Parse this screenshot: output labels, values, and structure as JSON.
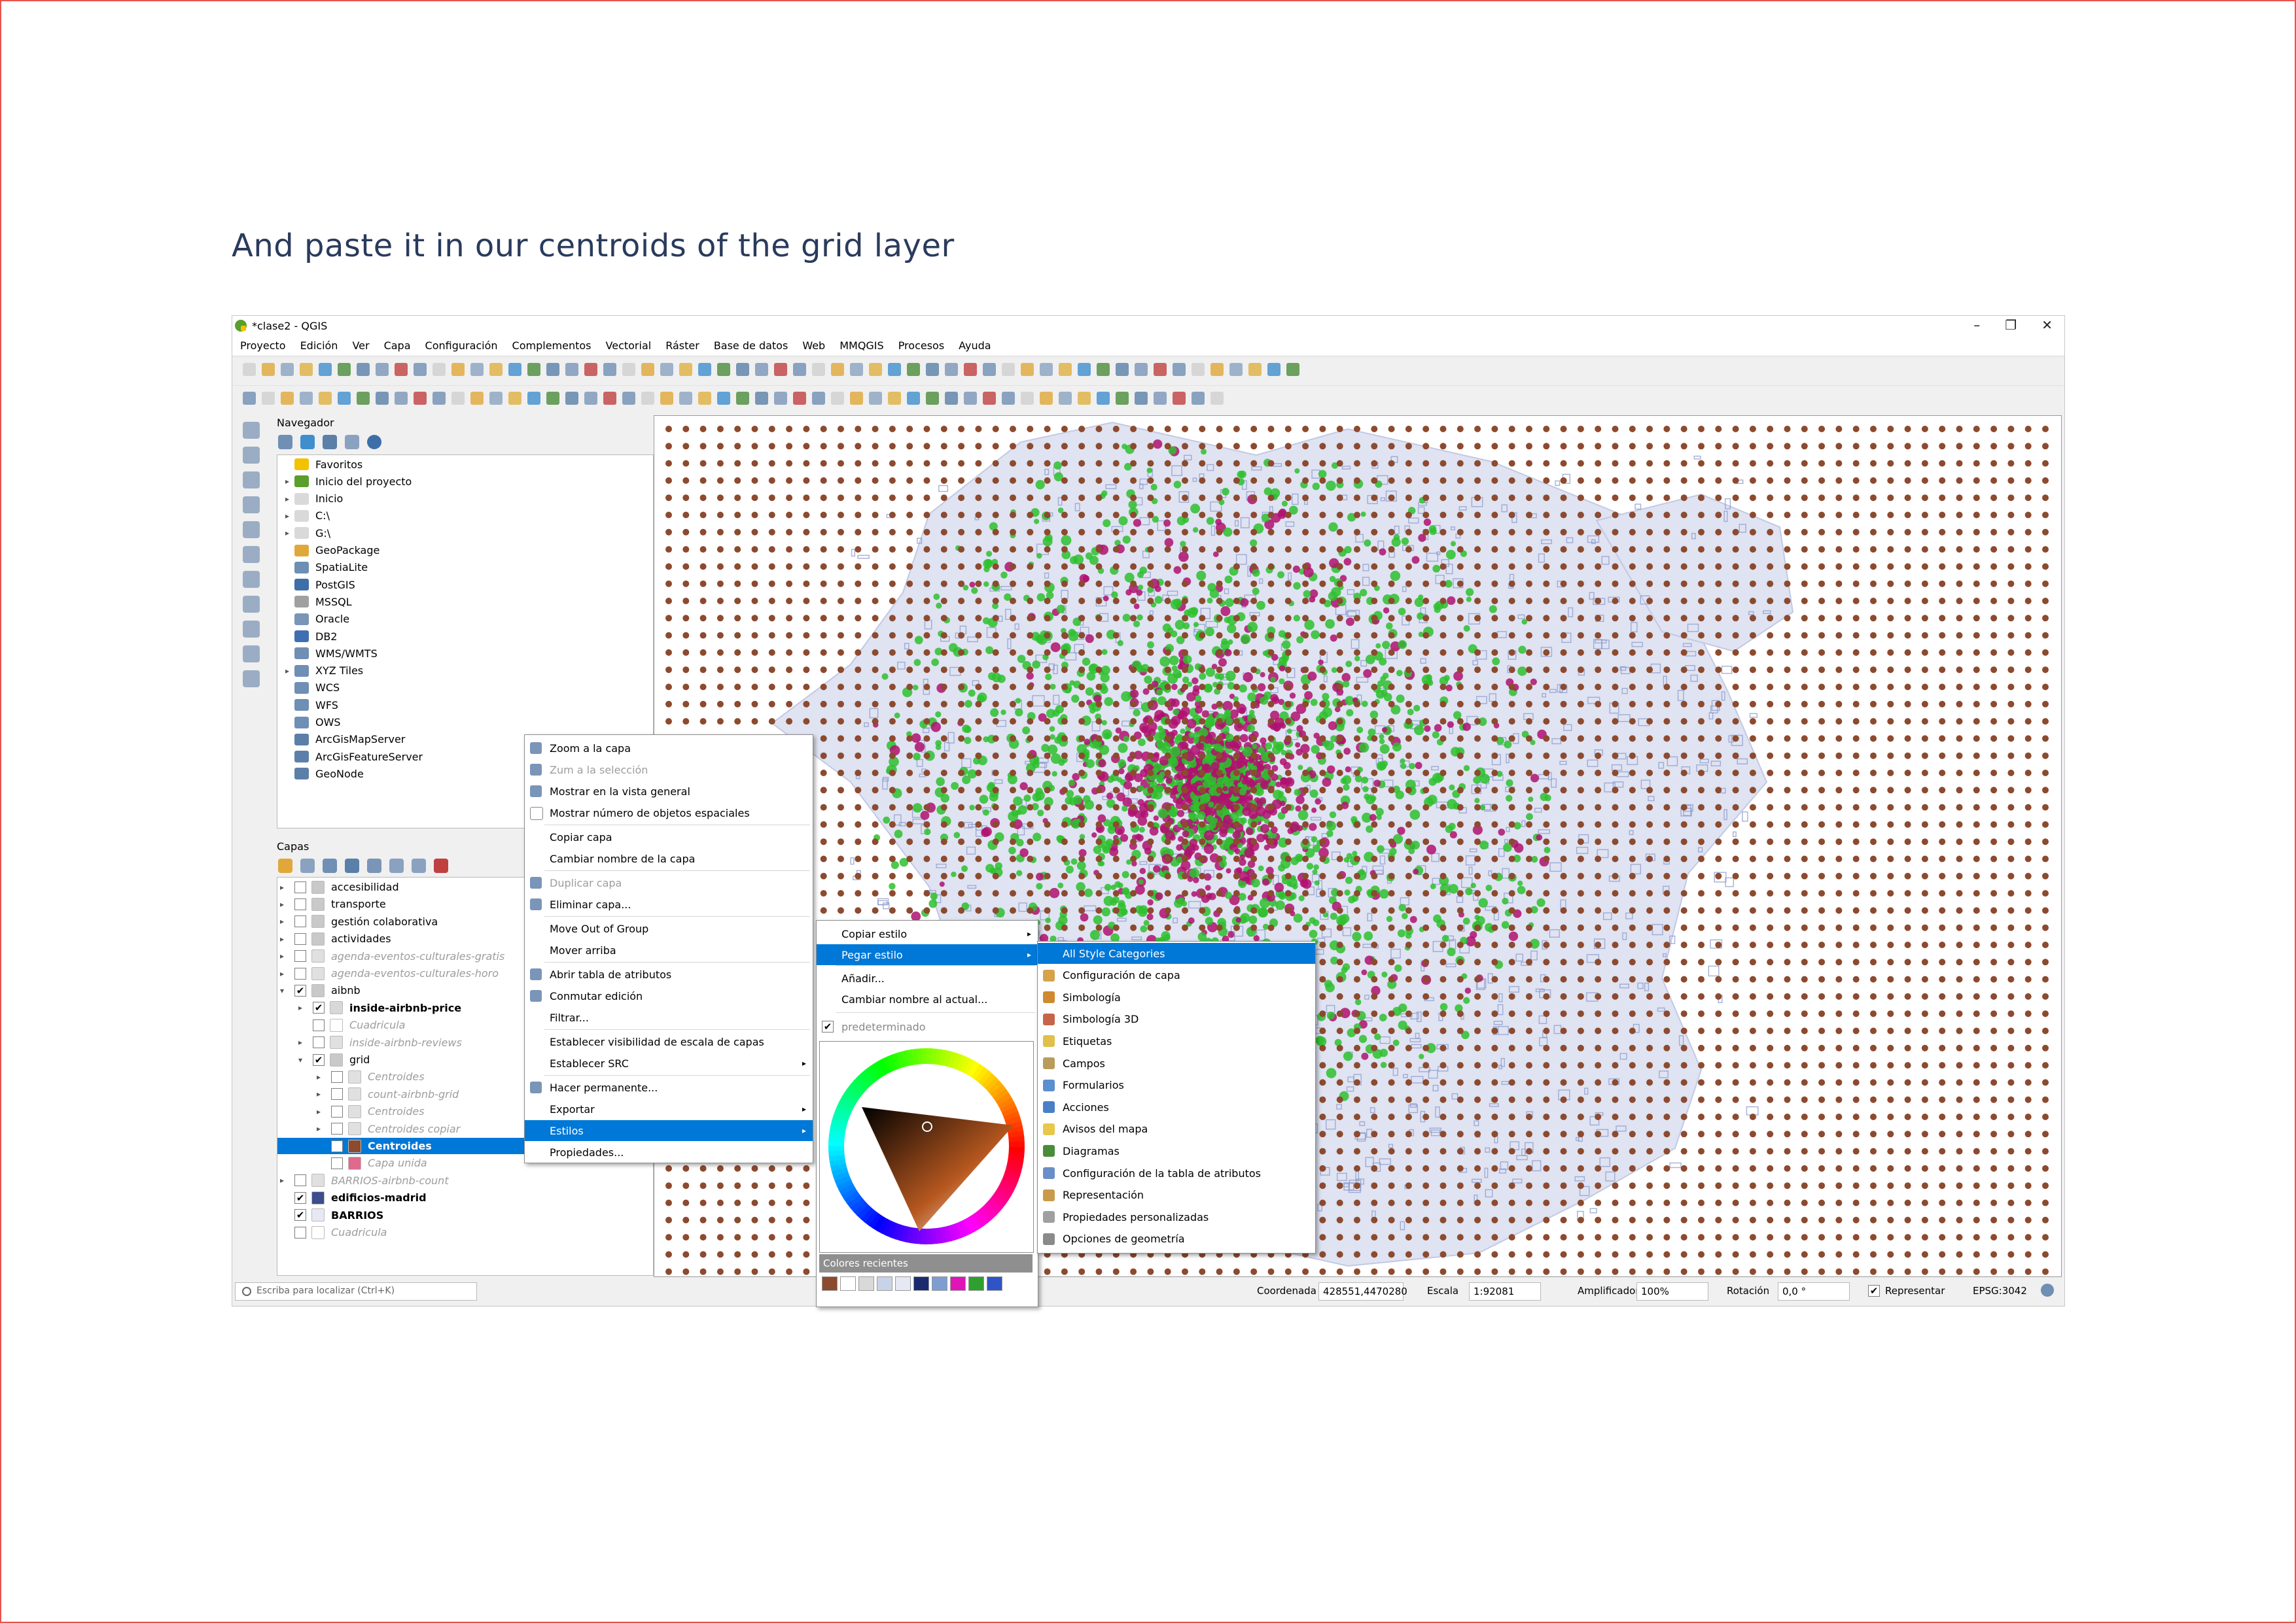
{
  "slide": {
    "title": "And paste it in our centroids of the grid layer"
  },
  "window": {
    "title": "*clase2 - QGIS",
    "minimize": "–",
    "restore": "❐",
    "close": "✕"
  },
  "menubar": [
    "Proyecto",
    "Edición",
    "Ver",
    "Capa",
    "Configuración",
    "Complementos",
    "Vectorial",
    "Ráster",
    "Base de datos",
    "Web",
    "MMQGIS",
    "Procesos",
    "Ayuda"
  ],
  "navigator": {
    "title": "Navegador",
    "items": [
      {
        "label": "Favoritos",
        "icon": "star-icon",
        "color": "#f2c200",
        "expand": ""
      },
      {
        "label": "Inicio del proyecto",
        "icon": "project-home-icon",
        "color": "#5a9e2c",
        "expand": "▸"
      },
      {
        "label": "Inicio",
        "icon": "home-folder-icon",
        "color": "#d9d9d9",
        "expand": "▸"
      },
      {
        "label": "C:\\",
        "icon": "drive-icon",
        "color": "#d9d9d9",
        "expand": "▸"
      },
      {
        "label": "G:\\",
        "icon": "drive-icon",
        "color": "#d9d9d9",
        "expand": "▸"
      },
      {
        "label": "GeoPackage",
        "icon": "geopackage-icon",
        "color": "#e0a83a",
        "expand": ""
      },
      {
        "label": "SpatiaLite",
        "icon": "spatialite-icon",
        "color": "#6d8fb3",
        "expand": ""
      },
      {
        "label": "PostGIS",
        "icon": "postgis-icon",
        "color": "#3d6ea8",
        "expand": ""
      },
      {
        "label": "MSSQL",
        "icon": "mssql-icon",
        "color": "#a0a0a0",
        "expand": ""
      },
      {
        "label": "Oracle",
        "icon": "oracle-icon",
        "color": "#7a95b8",
        "expand": ""
      },
      {
        "label": "DB2",
        "icon": "db2-icon",
        "color": "#3f6fb0",
        "expand": ""
      },
      {
        "label": "WMS/WMTS",
        "icon": "globe-icon",
        "color": "#6f8fb4",
        "expand": ""
      },
      {
        "label": "XYZ Tiles",
        "icon": "globe-icon",
        "color": "#6f8fb4",
        "expand": "▸"
      },
      {
        "label": "WCS",
        "icon": "globe-icon",
        "color": "#6f8fb4",
        "expand": ""
      },
      {
        "label": "WFS",
        "icon": "globe-icon",
        "color": "#6f8fb4",
        "expand": ""
      },
      {
        "label": "OWS",
        "icon": "globe-icon",
        "color": "#6f8fb4",
        "expand": ""
      },
      {
        "label": "ArcGisMapServer",
        "icon": "arcgis-icon",
        "color": "#5b7fa8",
        "expand": ""
      },
      {
        "label": "ArcGisFeatureServer",
        "icon": "arcgis-icon",
        "color": "#5b7fa8",
        "expand": ""
      },
      {
        "label": "GeoNode",
        "icon": "geonode-icon",
        "color": "#5b7fa8",
        "expand": ""
      }
    ]
  },
  "layers": {
    "title": "Capas",
    "rows": [
      {
        "label": "accesibilidad",
        "checked": "",
        "style": "",
        "expand": "▸",
        "level": 0,
        "icon": "group-icon",
        "color": "#c9c9c9",
        "selected": false
      },
      {
        "label": "transporte",
        "checked": "",
        "style": "",
        "expand": "▸",
        "level": 0,
        "icon": "group-icon",
        "color": "#c9c9c9",
        "selected": false
      },
      {
        "label": "gestión colaborativa",
        "checked": "",
        "style": "",
        "expand": "▸",
        "level": 0,
        "icon": "group-icon",
        "color": "#c9c9c9",
        "selected": false
      },
      {
        "label": "actividades",
        "checked": "",
        "style": "",
        "expand": "▸",
        "level": 0,
        "icon": "group-icon",
        "color": "#c9c9c9",
        "selected": false
      },
      {
        "label": "agenda-eventos-culturales-gratis",
        "checked": "",
        "style": "gray",
        "expand": "▸",
        "level": 0,
        "icon": "points-icon",
        "color": "#e0e0e0",
        "selected": false
      },
      {
        "label": "agenda-eventos-culturales-horo",
        "checked": "",
        "style": "gray",
        "expand": "▸",
        "level": 0,
        "icon": "points-icon",
        "color": "#e0e0e0",
        "selected": false
      },
      {
        "label": "aibnb",
        "checked": "✔",
        "style": "",
        "expand": "▾",
        "level": 0,
        "icon": "group-icon",
        "color": "#c9c9c9",
        "selected": false
      },
      {
        "label": "inside-airbnb-price",
        "checked": "✔",
        "style": "bold",
        "expand": "▸",
        "level": 1,
        "icon": "points-icon",
        "color": "#d8d8d8",
        "selected": false
      },
      {
        "label": "Cuadricula",
        "checked": "",
        "style": "gray",
        "expand": "",
        "level": 1,
        "icon": "blank-icon",
        "color": "#ffffff",
        "selected": false
      },
      {
        "label": "inside-airbnb-reviews",
        "checked": "",
        "style": "gray",
        "expand": "▸",
        "level": 1,
        "icon": "points-icon",
        "color": "#e0e0e0",
        "selected": false
      },
      {
        "label": "grid",
        "checked": "✔",
        "style": "",
        "expand": "▾",
        "level": 1,
        "icon": "group-icon",
        "color": "#c9c9c9",
        "selected": false
      },
      {
        "label": "Centroides",
        "checked": "",
        "style": "gray",
        "expand": "▸",
        "level": 2,
        "icon": "points-icon",
        "color": "#e0e0e0",
        "selected": false
      },
      {
        "label": "count-airbnb-grid",
        "checked": "",
        "style": "gray",
        "expand": "▸",
        "level": 2,
        "icon": "polygon-icon",
        "color": "#e0e0e0",
        "selected": false
      },
      {
        "label": "Centroides",
        "checked": "",
        "style": "gray",
        "expand": "▸",
        "level": 2,
        "icon": "points-icon",
        "color": "#e0e0e0",
        "selected": false
      },
      {
        "label": "Centroides copiar",
        "checked": "",
        "style": "gray",
        "expand": "▸",
        "level": 2,
        "icon": "points-icon",
        "color": "#e0e0e0",
        "selected": false
      },
      {
        "label": "Centroides",
        "checked": "✔",
        "style": "bold",
        "expand": "",
        "level": 2,
        "icon": "point-icon",
        "color": "#8c4a2f",
        "selected": true
      },
      {
        "label": "Capa unida",
        "checked": "",
        "style": "gray",
        "expand": "",
        "level": 2,
        "icon": "fill-icon",
        "color": "#e06a8c",
        "selected": false
      },
      {
        "label": "BARRIOS-airbnb-count",
        "checked": "",
        "style": "gray",
        "expand": "▸",
        "level": 0,
        "icon": "polygon-icon",
        "color": "#e0e0e0",
        "selected": false
      },
      {
        "label": "edificios-madrid",
        "checked": "✔",
        "style": "bold",
        "expand": "",
        "level": 0,
        "icon": "fill-icon",
        "color": "#3d4e8c",
        "selected": false
      },
      {
        "label": "BARRIOS",
        "checked": "✔",
        "style": "bold",
        "expand": "",
        "level": 0,
        "icon": "fill-icon",
        "color": "#e6e8f4",
        "selected": false
      },
      {
        "label": "Cuadricula",
        "checked": "",
        "style": "gray",
        "expand": "",
        "level": 0,
        "icon": "blank-icon",
        "color": "#ffffff",
        "selected": false
      }
    ]
  },
  "context_menu": [
    {
      "label": "Zoom a la capa",
      "icon": "zoom-layer-icon",
      "disabled": false,
      "sub": "",
      "highlight": false
    },
    {
      "label": "Zum a la selección",
      "icon": "zoom-selection-icon",
      "disabled": true,
      "sub": "",
      "highlight": false
    },
    {
      "label": "Mostrar en la vista general",
      "icon": "overview-icon",
      "disabled": false,
      "sub": "",
      "highlight": false
    },
    {
      "label": "Mostrar número de objetos espaciales",
      "icon": "checkbox-icon",
      "disabled": false,
      "sub": "",
      "highlight": false
    },
    {
      "label": "Copiar capa",
      "icon": "",
      "disabled": false,
      "sub": "",
      "highlight": false
    },
    {
      "label": "Cambiar nombre de la capa",
      "icon": "",
      "disabled": false,
      "sub": "",
      "highlight": false
    },
    {
      "label": "Duplicar capa",
      "icon": "duplicate-icon",
      "disabled": true,
      "sub": "",
      "highlight": false
    },
    {
      "label": "Eliminar capa...",
      "icon": "remove-layer-icon",
      "disabled": false,
      "sub": "",
      "highlight": false
    },
    {
      "label": "Move Out of Group",
      "icon": "",
      "disabled": false,
      "sub": "",
      "highlight": false
    },
    {
      "label": "Mover arriba",
      "icon": "",
      "disabled": false,
      "sub": "",
      "highlight": false
    },
    {
      "label": "Abrir tabla de atributos",
      "icon": "attribute-table-icon",
      "disabled": false,
      "sub": "",
      "highlight": false
    },
    {
      "label": "Conmutar edición",
      "icon": "pencil-icon",
      "disabled": false,
      "sub": "",
      "highlight": false
    },
    {
      "label": "Filtrar...",
      "icon": "",
      "disabled": false,
      "sub": "",
      "highlight": false
    },
    {
      "label": "Establecer visibilidad de escala de capas",
      "icon": "",
      "disabled": false,
      "sub": "",
      "highlight": false
    },
    {
      "label": "Establecer SRC",
      "icon": "",
      "disabled": false,
      "sub": "▸",
      "highlight": false
    },
    {
      "label": "Hacer permanente...",
      "icon": "save-icon",
      "disabled": false,
      "sub": "",
      "highlight": false
    },
    {
      "label": "Exportar",
      "icon": "",
      "disabled": false,
      "sub": "▸",
      "highlight": false
    },
    {
      "label": "Estilos",
      "icon": "",
      "disabled": false,
      "sub": "▸",
      "highlight": true
    },
    {
      "label": "Propiedades...",
      "icon": "",
      "disabled": false,
      "sub": "",
      "highlight": false
    }
  ],
  "styles_menu": {
    "items": [
      {
        "label": "Copiar estilo",
        "sub": "▸",
        "highlight": false
      },
      {
        "label": "Pegar estilo",
        "sub": "▸",
        "highlight": true
      },
      {
        "label": "Añadir...",
        "sub": "",
        "highlight": false
      },
      {
        "label": "Cambiar nombre al actual...",
        "sub": "",
        "highlight": false
      }
    ],
    "default_style": "predeterminado",
    "default_check": "✔",
    "recent_colors_label": "Colores recientes",
    "recent_colors": [
      "#8c4a2f",
      "#ffffff",
      "#d9d9d9",
      "#c9d3e8",
      "#e6e8f4",
      "#1c2b6e",
      "#7e9dd1",
      "#e015b8",
      "#2ea02e",
      "#3054c8"
    ]
  },
  "paste_menu": [
    {
      "label": "All Style Categories",
      "icon": "",
      "color": "#0078d7",
      "highlight": true
    },
    {
      "label": "Configuración de capa",
      "icon": "layer-config-icon",
      "color": "#d6a24a",
      "highlight": false
    },
    {
      "label": "Simbología",
      "icon": "symbology-icon",
      "color": "#d08a2e",
      "highlight": false
    },
    {
      "label": "Simbología 3D",
      "icon": "symbology-3d-icon",
      "color": "#c8644a",
      "highlight": false
    },
    {
      "label": "Etiquetas",
      "icon": "labels-icon",
      "color": "#e0c04a",
      "highlight": false
    },
    {
      "label": "Campos",
      "icon": "fields-icon",
      "color": "#b89c5a",
      "highlight": false
    },
    {
      "label": "Formularios",
      "icon": "forms-icon",
      "color": "#5a8fd0",
      "highlight": false
    },
    {
      "label": "Acciones",
      "icon": "actions-icon",
      "color": "#4a7fc8",
      "highlight": false
    },
    {
      "label": "Avisos del mapa",
      "icon": "map-tips-icon",
      "color": "#e8c84a",
      "highlight": false
    },
    {
      "label": "Diagramas",
      "icon": "diagrams-icon",
      "color": "#4a8c3a",
      "highlight": false
    },
    {
      "label": "Configuración de la tabla de atributos",
      "icon": "attribute-table-config-icon",
      "color": "#6a8fc8",
      "highlight": false
    },
    {
      "label": "Representación",
      "icon": "rendering-icon",
      "color": "#c89a4a",
      "highlight": false
    },
    {
      "label": "Propiedades personalizadas",
      "icon": "custom-properties-icon",
      "color": "#a0a0a0",
      "highlight": false
    },
    {
      "label": "Opciones de geometría",
      "icon": "geometry-options-icon",
      "color": "#8a8a8a",
      "highlight": false
    }
  ],
  "statusbar": {
    "search_placeholder": "Escriba para localizar (Ctrl+K)",
    "coord_label": "Coordenada",
    "coord_value": "428551,4470280",
    "scale_label": "Escala",
    "scale_value": "1:92081",
    "magnifier_label": "Amplificador",
    "magnifier_value": "100%",
    "rotation_label": "Rotación",
    "rotation_value": "0,0 °",
    "render_label": "Representar",
    "crs": "EPSG:3042"
  },
  "map_colors": {
    "grid_point": "#8c4a2f",
    "barrios": "#dfe3f2",
    "building": "#8f9ccc",
    "price_green": "#2ec02e",
    "price_magenta": "#b0106e"
  },
  "toolbar_icons": [
    "new-project-icon",
    "open-project-icon",
    "save-project-icon",
    "pan-icon",
    "zoom-in-icon",
    "zoom-out-icon",
    "identify-icon",
    "select-icon",
    "measure-icon",
    "attribute-table-icon",
    "digitize-icon"
  ]
}
